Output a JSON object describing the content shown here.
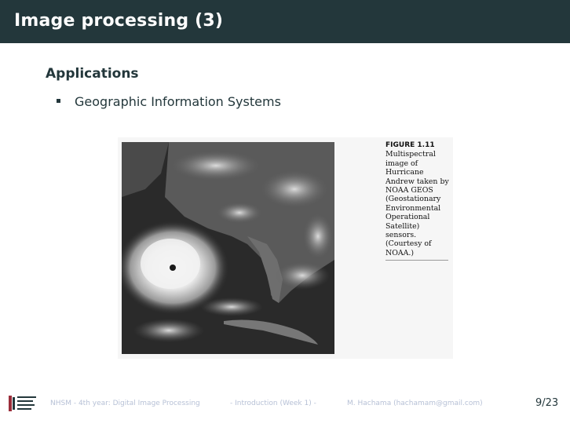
{
  "slide": {
    "title": "Image processing (3)",
    "block_title": "Applications",
    "bullets": [
      "Geographic Information Systems"
    ]
  },
  "figure": {
    "id": "FIGURE 1.11",
    "caption_lines": [
      "Multispectral",
      "image of",
      "Hurricane",
      "Andrew taken by",
      "NOAA GEOS",
      "(Geostationary",
      "Environmental",
      "Operational",
      "Satellite) sensors.",
      "(Courtesy of",
      "NOAA.)"
    ]
  },
  "footer": {
    "course": "NHSM - 4th year: Digital Image Processing",
    "section": "- Introduction (Week 1) -",
    "author": "M. Hachama (hachamam@gmail.com)",
    "page": "9/23"
  },
  "colors": {
    "header_bg": "#23373b",
    "text": "#23373b",
    "footer_text": "#b7c1d6"
  }
}
